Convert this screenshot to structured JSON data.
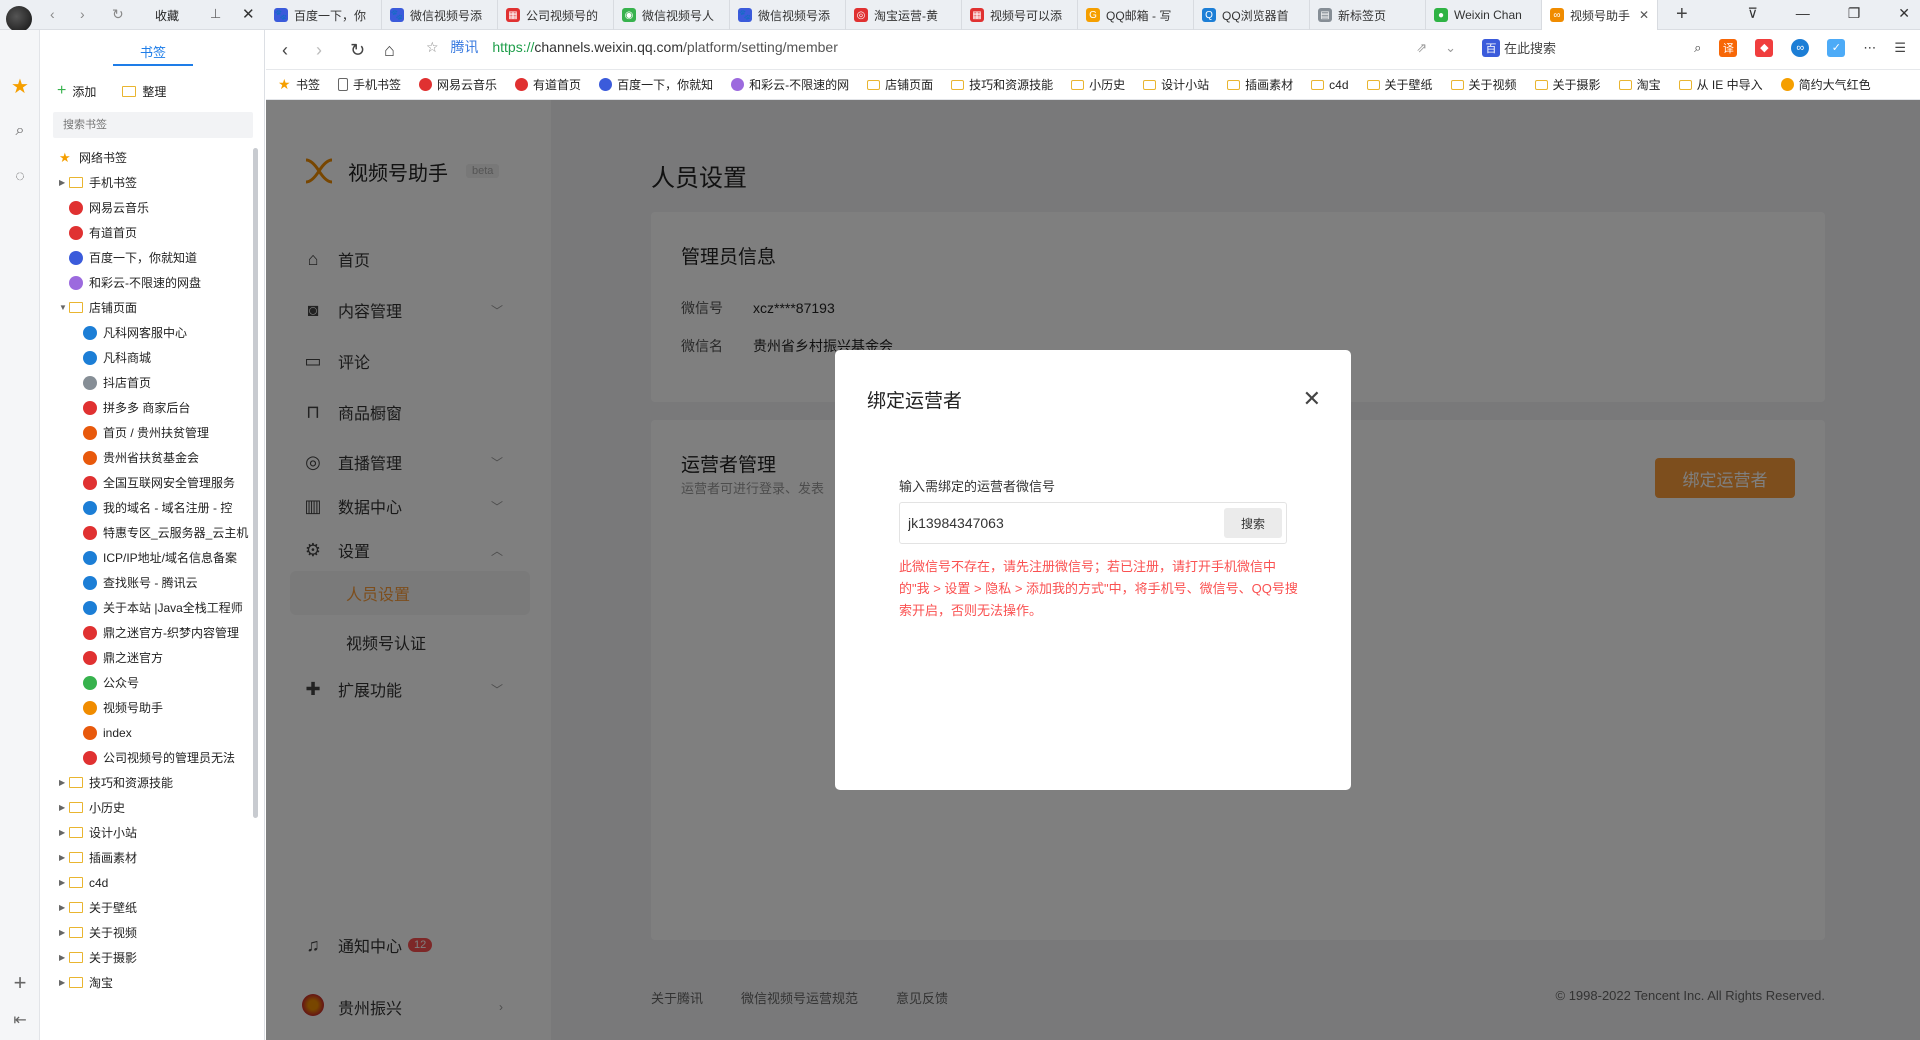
{
  "browser": {
    "collect_label": "收藏",
    "tabs": [
      {
        "label": "百度一下，你",
        "color": "#3b5bdb",
        "glyph": "🐾"
      },
      {
        "label": "微信视频号添",
        "color": "#3b5bdb",
        "glyph": "🐾"
      },
      {
        "label": "公司视频号的",
        "color": "#e03131",
        "glyph": "▦"
      },
      {
        "label": "微信视频号人",
        "color": "#37b24d",
        "glyph": "◉"
      },
      {
        "label": "微信视频号添",
        "color": "#3b5bdb",
        "glyph": "🐾"
      },
      {
        "label": "淘宝运营-黄",
        "color": "#e03131",
        "glyph": "◎"
      },
      {
        "label": "视频号可以添",
        "color": "#e03131",
        "glyph": "▦"
      },
      {
        "label": "QQ邮箱 - 写",
        "color": "#f59f00",
        "glyph": "G"
      },
      {
        "label": "QQ浏览器首",
        "color": "#1c7ed6",
        "glyph": "Q"
      },
      {
        "label": "新标签页",
        "color": "#868e96",
        "glyph": "▤"
      },
      {
        "label": "Weixin Chan",
        "color": "#2fb344",
        "glyph": "●"
      },
      {
        "label": "视频号助手",
        "color": "#f08c00",
        "glyph": "∞",
        "active": true
      }
    ],
    "url_site_label": "腾讯",
    "url_scheme": "https://",
    "url_domain": "channels.weixin.qq.com",
    "url_path": "/platform/setting/member",
    "search_label": "在此搜索"
  },
  "bookmark_panel": {
    "title": "书签",
    "add_label": "添加",
    "organize_label": "整理",
    "search_placeholder": "搜索书签",
    "items": [
      {
        "label": "网络书签",
        "type": "root",
        "indent": 0
      },
      {
        "label": "手机书签",
        "type": "folder",
        "indent": 1
      },
      {
        "label": "网易云音乐",
        "type": "site",
        "indent": 1,
        "color": "#e03131"
      },
      {
        "label": "有道首页",
        "type": "site",
        "indent": 1,
        "color": "#e03131"
      },
      {
        "label": "百度一下，你就知道",
        "type": "site",
        "indent": 1,
        "color": "#3b5bdb"
      },
      {
        "label": "和彩云-不限速的网盘",
        "type": "site",
        "indent": 1,
        "color": "#9c6ade"
      },
      {
        "label": "店铺页面",
        "type": "folder-open",
        "indent": 1
      },
      {
        "label": "凡科网客服中心",
        "type": "site",
        "indent": 2,
        "color": "#1c7ed6"
      },
      {
        "label": "凡科商城",
        "type": "site",
        "indent": 2,
        "color": "#1c7ed6"
      },
      {
        "label": "抖店首页",
        "type": "site",
        "indent": 2,
        "color": "#868e96"
      },
      {
        "label": "拼多多 商家后台",
        "type": "site",
        "indent": 2,
        "color": "#e03131"
      },
      {
        "label": "首页 / 贵州扶贫管理",
        "type": "site",
        "indent": 2,
        "color": "#e8590c"
      },
      {
        "label": "贵州省扶贫基金会",
        "type": "site",
        "indent": 2,
        "color": "#e8590c"
      },
      {
        "label": "全国互联网安全管理服务",
        "type": "site",
        "indent": 2,
        "color": "#e03131"
      },
      {
        "label": "我的域名 - 域名注册 - 控",
        "type": "site",
        "indent": 2,
        "color": "#1c7ed6"
      },
      {
        "label": "特惠专区_云服务器_云主机",
        "type": "site",
        "indent": 2,
        "color": "#e03131"
      },
      {
        "label": "ICP/IP地址/域名信息备案",
        "type": "site",
        "indent": 2,
        "color": "#1c7ed6"
      },
      {
        "label": "查找账号 - 腾讯云",
        "type": "site",
        "indent": 2,
        "color": "#1c7ed6"
      },
      {
        "label": "关于本站 |Java全栈工程师",
        "type": "site",
        "indent": 2,
        "color": "#1c7ed6"
      },
      {
        "label": "鼎之迷官方-织梦内容管理",
        "type": "site",
        "indent": 2,
        "color": "#e03131"
      },
      {
        "label": "鼎之迷官方",
        "type": "site",
        "indent": 2,
        "color": "#e03131"
      },
      {
        "label": "公众号",
        "type": "site",
        "indent": 2,
        "color": "#37b24d"
      },
      {
        "label": "视频号助手",
        "type": "site",
        "indent": 2,
        "color": "#f08c00"
      },
      {
        "label": "index",
        "type": "site",
        "indent": 2,
        "color": "#e8590c"
      },
      {
        "label": "公司视频号的管理员无法",
        "type": "site",
        "indent": 2,
        "color": "#e03131"
      },
      {
        "label": "技巧和资源技能",
        "type": "folder",
        "indent": 1
      },
      {
        "label": "小历史",
        "type": "folder",
        "indent": 1
      },
      {
        "label": "设计小站",
        "type": "folder",
        "indent": 1
      },
      {
        "label": "插画素材",
        "type": "folder",
        "indent": 1
      },
      {
        "label": "c4d",
        "type": "folder",
        "indent": 1
      },
      {
        "label": "关于壁纸",
        "type": "folder",
        "indent": 1
      },
      {
        "label": "关于视频",
        "type": "folder",
        "indent": 1
      },
      {
        "label": "关于摄影",
        "type": "folder",
        "indent": 1
      },
      {
        "label": "淘宝",
        "type": "folder",
        "indent": 1
      }
    ]
  },
  "bookmark_bar": [
    {
      "label": "书签",
      "type": "star"
    },
    {
      "label": "手机书签",
      "type": "page"
    },
    {
      "label": "网易云音乐",
      "type": "site",
      "color": "#e03131"
    },
    {
      "label": "有道首页",
      "type": "site",
      "color": "#e03131"
    },
    {
      "label": "百度一下，你就知",
      "type": "site",
      "color": "#3b5bdb"
    },
    {
      "label": "和彩云-不限速的网",
      "type": "site",
      "color": "#9c6ade"
    },
    {
      "label": "店铺页面",
      "type": "folder"
    },
    {
      "label": "技巧和资源技能",
      "type": "folder"
    },
    {
      "label": "小历史",
      "type": "folder"
    },
    {
      "label": "设计小站",
      "type": "folder"
    },
    {
      "label": "插画素材",
      "type": "folder"
    },
    {
      "label": "c4d",
      "type": "folder"
    },
    {
      "label": "关于壁纸",
      "type": "folder"
    },
    {
      "label": "关于视频",
      "type": "folder"
    },
    {
      "label": "关于摄影",
      "type": "folder"
    },
    {
      "label": "淘宝",
      "type": "folder"
    },
    {
      "label": "从 IE 中导入",
      "type": "folder"
    },
    {
      "label": "简约大气红色",
      "type": "site",
      "color": "#f59f00"
    }
  ],
  "app": {
    "name": "视频号助手",
    "beta": "beta",
    "nav": {
      "home": "首页",
      "content": "内容管理",
      "comments": "评论",
      "shop": "商品橱窗",
      "live": "直播管理",
      "data": "数据中心",
      "settings": "设置",
      "members": "人员设置",
      "verify": "视频号认证",
      "extend": "扩展功能",
      "notify": "通知中心",
      "notify_count": "12",
      "account": "贵州振兴"
    },
    "page_title": "人员设置",
    "admin": {
      "heading": "管理员信息",
      "wechat_id_label": "微信号",
      "wechat_id_value": "xcz****87193",
      "wechat_name_label": "微信名",
      "wechat_name_value": "贵州省乡村振兴基金会"
    },
    "operator": {
      "heading": "运营者管理",
      "desc": "运营者可进行登录、发表",
      "bind_button": "绑定运营者"
    },
    "footer": {
      "links": [
        "关于腾讯",
        "微信视频号运营规范",
        "意见反馈"
      ],
      "copyright": "© 1998-2022 Tencent Inc. All Rights Reserved."
    }
  },
  "dialog": {
    "title": "绑定运营者",
    "label": "输入需绑定的运营者微信号",
    "input_value": "jk13984347063",
    "search_button": "搜索",
    "error": "此微信号不存在，请先注册微信号；若已注册，请打开手机微信中的\"我 > 设置 > 隐私 > 添加我的方式\"中，将手机号、微信号、QQ号搜索开启，否则无法操作。"
  }
}
